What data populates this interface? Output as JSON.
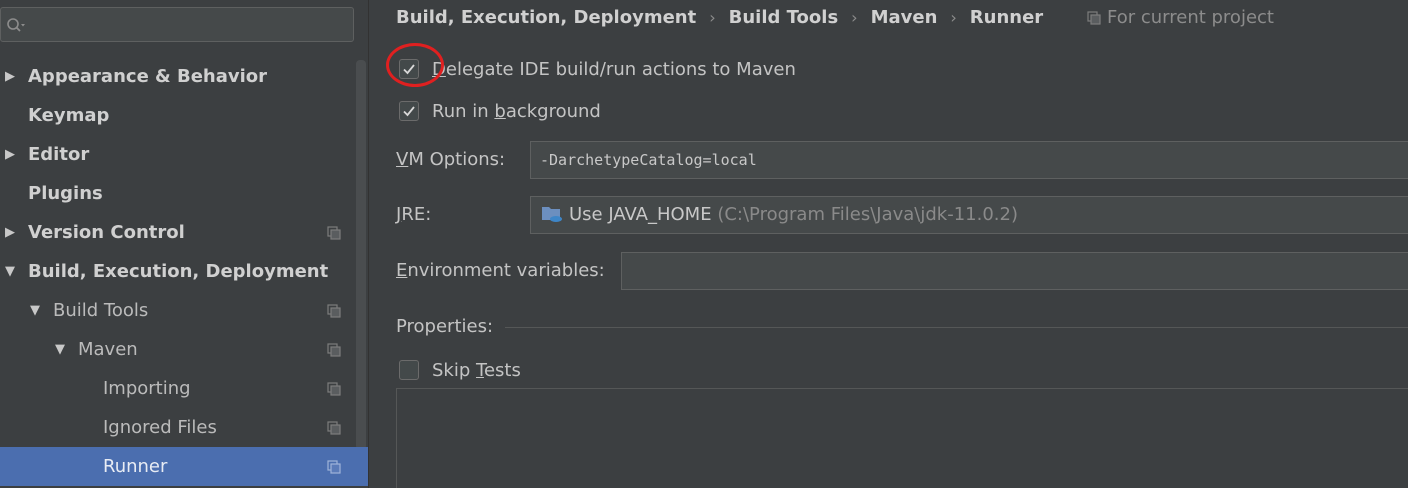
{
  "sidebar": {
    "search_placeholder": "",
    "items": [
      {
        "label": "Appearance & Behavior",
        "arrow": "▶"
      },
      {
        "label": "Keymap",
        "arrow": ""
      },
      {
        "label": "Editor",
        "arrow": "▶"
      },
      {
        "label": "Plugins",
        "arrow": ""
      },
      {
        "label": "Version Control",
        "arrow": "▶"
      },
      {
        "label": "Build, Execution, Deployment",
        "arrow": "▼"
      },
      {
        "label": "Build Tools",
        "arrow": "▼"
      },
      {
        "label": "Maven",
        "arrow": "▼"
      },
      {
        "label": "Importing",
        "arrow": ""
      },
      {
        "label": "Ignored Files",
        "arrow": ""
      },
      {
        "label": "Runner",
        "arrow": ""
      }
    ]
  },
  "breadcrumb": {
    "items": [
      "Build, Execution, Deployment",
      "Build Tools",
      "Maven",
      "Runner"
    ],
    "separator": "›",
    "scope": "For current project"
  },
  "runner": {
    "delegate": {
      "first": "D",
      "rest": "elegate IDE build/run actions to Maven",
      "checked": true
    },
    "background": {
      "before": "Run in ",
      "mnemonic": "b",
      "after": "ackground",
      "checked": true
    },
    "vm_options": {
      "mnemonic": "V",
      "rest": "M Options:",
      "value": "-DarchetypeCatalog=local"
    },
    "jre": {
      "mnemonic": "J",
      "rest": "RE:",
      "value": "Use JAVA_HOME",
      "hint": "(C:\\Program Files\\Java\\jdk-11.0.2)"
    },
    "env": {
      "mnemonic": "E",
      "rest": "nvironment variables:",
      "value": ""
    },
    "properties_label": "Properties:",
    "skip_tests": {
      "before": "Skip ",
      "mnemonic": "T",
      "after": "ests",
      "checked": false
    }
  },
  "colors": {
    "background": "#3c3f41",
    "selection": "#4b6eaf",
    "annotation_circle": "#e02020"
  }
}
